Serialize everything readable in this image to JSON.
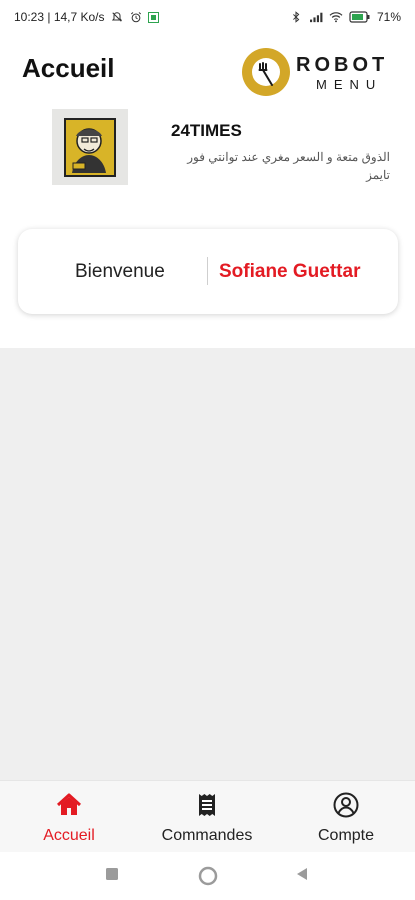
{
  "status_bar": {
    "time_speed": "10:23 | 14,7 Ko/s",
    "battery": "71"
  },
  "header": {
    "title": "Accueil",
    "logo_word": "ROBOT",
    "logo_sub": "MENU"
  },
  "restaurant": {
    "name": "24TIMES",
    "description": "الذوق متعة و السعر مغري عند توانتي فور تايمز"
  },
  "welcome": {
    "label": "Bienvenue",
    "user_name": "Sofiane Guettar"
  },
  "bottom_nav": [
    {
      "label": "Accueil",
      "icon": "home-icon",
      "active": true
    },
    {
      "label": "Commandes",
      "icon": "receipt-icon",
      "active": false
    },
    {
      "label": "Compte",
      "icon": "account-icon",
      "active": false
    }
  ],
  "colors": {
    "accent": "#e31b23",
    "logo_gold": "#d3a728",
    "inactive": "#222222"
  }
}
